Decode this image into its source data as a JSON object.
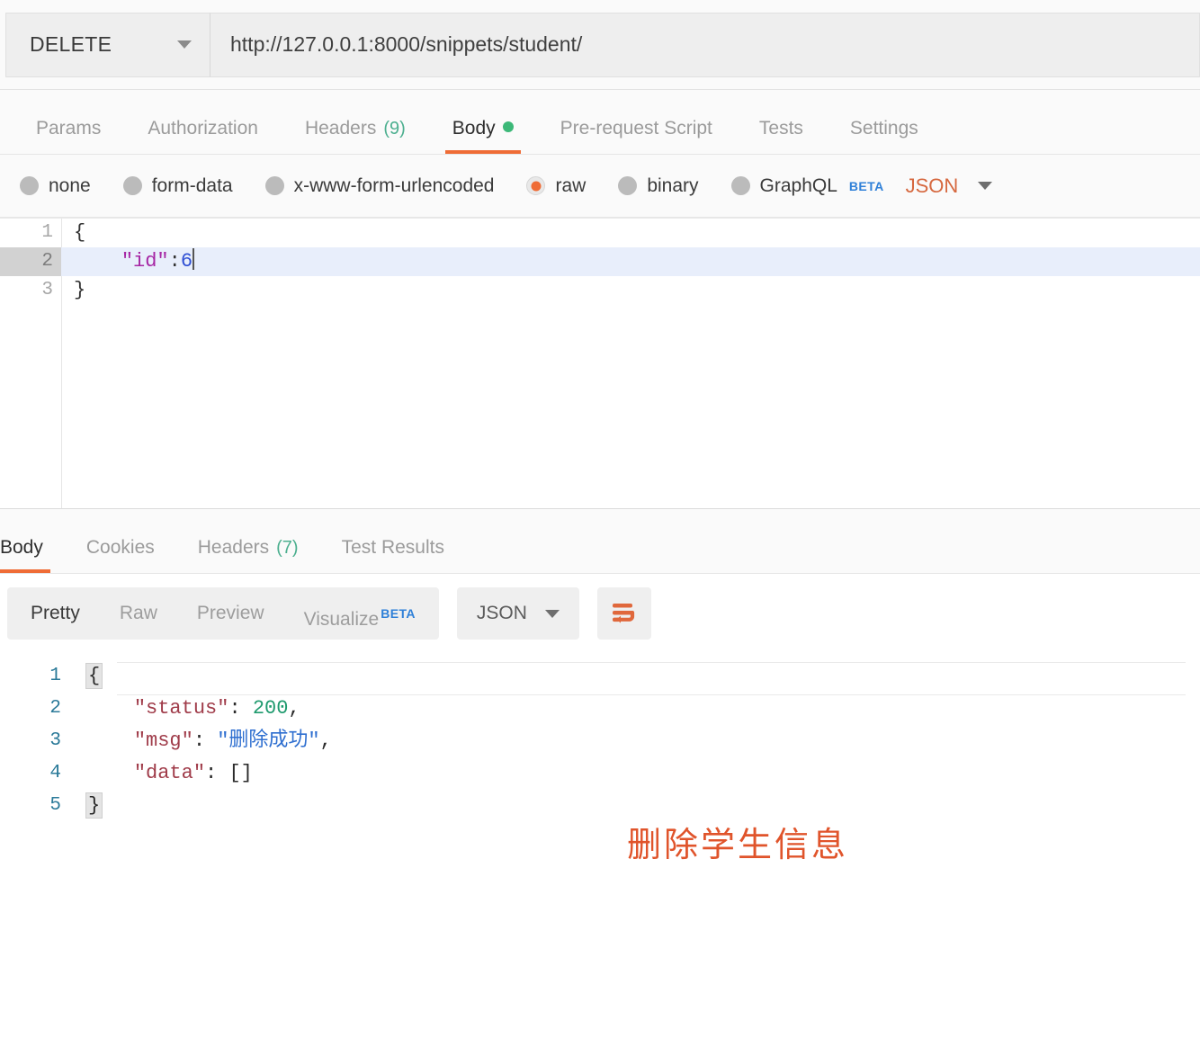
{
  "request": {
    "method": "DELETE",
    "url": "http://127.0.0.1:8000/snippets/student/",
    "tabs": [
      {
        "label": "Params",
        "badge": "",
        "active": false
      },
      {
        "label": "Authorization",
        "badge": "",
        "active": false
      },
      {
        "label": "Headers",
        "badge": "(9)",
        "active": false
      },
      {
        "label": "Body",
        "badge": "",
        "active": true
      },
      {
        "label": "Pre-request Script",
        "badge": "",
        "active": false
      },
      {
        "label": "Tests",
        "badge": "",
        "active": false
      },
      {
        "label": "Settings",
        "badge": "",
        "active": false
      }
    ],
    "body_types": [
      {
        "label": "none",
        "selected": false
      },
      {
        "label": "form-data",
        "selected": false
      },
      {
        "label": "x-www-form-urlencoded",
        "selected": false
      },
      {
        "label": "raw",
        "selected": true
      },
      {
        "label": "binary",
        "selected": false
      },
      {
        "label": "GraphQL",
        "selected": false,
        "beta": "BETA"
      }
    ],
    "raw_format": "JSON",
    "editor": {
      "lines": [
        {
          "num": "1",
          "open_brace": "{",
          "fold": true
        },
        {
          "num": "2",
          "key": "\"id\"",
          "colon": ":",
          "value": "6",
          "active": true
        },
        {
          "num": "3",
          "close_brace": "}"
        }
      ]
    }
  },
  "response": {
    "tabs": [
      {
        "label": "Body",
        "badge": "",
        "active": true
      },
      {
        "label": "Cookies",
        "badge": "",
        "active": false
      },
      {
        "label": "Headers",
        "badge": "(7)",
        "active": false
      },
      {
        "label": "Test Results",
        "badge": "",
        "active": false
      }
    ],
    "view_modes": [
      {
        "label": "Pretty",
        "active": true
      },
      {
        "label": "Raw",
        "active": false
      },
      {
        "label": "Preview",
        "active": false
      },
      {
        "label": "Visualize",
        "active": false,
        "beta": "BETA"
      }
    ],
    "format": "JSON",
    "wrap_icon": "word-wrap-icon",
    "body_lines": [
      {
        "num": "1",
        "text": "{"
      },
      {
        "num": "2",
        "key": "\"status\"",
        "sep": ": ",
        "num_value": "200",
        "tail": ","
      },
      {
        "num": "3",
        "key": "\"msg\"",
        "sep": ": ",
        "str_value": "\"删除成功\"",
        "tail": ","
      },
      {
        "num": "4",
        "key": "\"data\"",
        "sep": ": ",
        "plain_value": "[]"
      },
      {
        "num": "5",
        "text": "}"
      }
    ]
  },
  "annotation": {
    "text": "删除学生信息",
    "color": "#e0542b"
  },
  "colors": {
    "accent_orange": "#ef6c36",
    "badge_green": "#4caf8f",
    "beta_blue": "#2f80d8",
    "annotation": "#e0542b"
  }
}
